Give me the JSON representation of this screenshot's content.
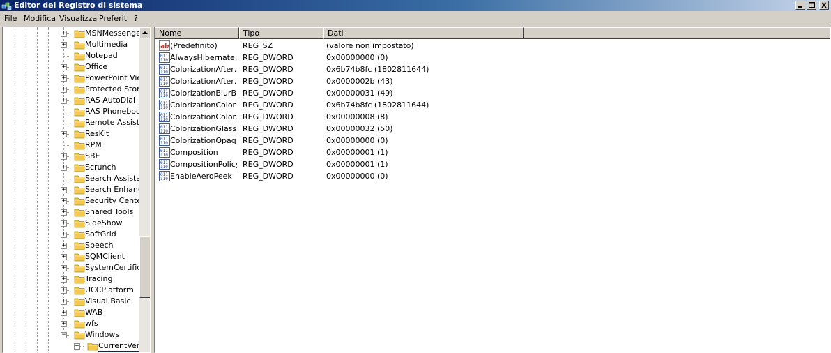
{
  "window": {
    "title": "Editor del Registro di sistema",
    "controls": [
      "_",
      "□",
      "×"
    ]
  },
  "menu": [
    "File",
    "Modifica",
    "Visualizza",
    "Preferiti",
    "?"
  ],
  "tree": {
    "items": [
      {
        "label": "MSNMessenger",
        "expander": "+"
      },
      {
        "label": "Multimedia",
        "expander": "+"
      },
      {
        "label": "Notepad",
        "expander": ""
      },
      {
        "label": "Office",
        "expander": "+"
      },
      {
        "label": "PowerPoint View",
        "expander": "+"
      },
      {
        "label": "Protected Storag",
        "expander": "+"
      },
      {
        "label": "RAS AutoDial",
        "expander": "+"
      },
      {
        "label": "RAS Phonebook",
        "expander": ""
      },
      {
        "label": "Remote Assistar",
        "expander": ""
      },
      {
        "label": "ResKit",
        "expander": "+"
      },
      {
        "label": "RPM",
        "expander": ""
      },
      {
        "label": "SBE",
        "expander": "+"
      },
      {
        "label": "Scrunch",
        "expander": "+"
      },
      {
        "label": "Search Assistant",
        "expander": ""
      },
      {
        "label": "Search Enhance",
        "expander": "+"
      },
      {
        "label": "Security Center",
        "expander": "+"
      },
      {
        "label": "Shared Tools",
        "expander": "+"
      },
      {
        "label": "SideShow",
        "expander": "+"
      },
      {
        "label": "SoftGrid",
        "expander": "+"
      },
      {
        "label": "Speech",
        "expander": "+"
      },
      {
        "label": "SQMClient",
        "expander": "+"
      },
      {
        "label": "SystemCertificat",
        "expander": "+"
      },
      {
        "label": "Tracing",
        "expander": "+"
      },
      {
        "label": "UCCPlatform",
        "expander": "+"
      },
      {
        "label": "Visual Basic",
        "expander": "+"
      },
      {
        "label": "WAB",
        "expander": "+"
      },
      {
        "label": "wfs",
        "expander": "+"
      },
      {
        "label": "Windows",
        "expander": "−"
      },
      {
        "label": "CurrentVers",
        "expander": "+",
        "child": true
      }
    ]
  },
  "list": {
    "columns": [
      "Nome",
      "Tipo",
      "Dati"
    ],
    "rows": [
      {
        "icon": "string-value-icon",
        "name": "(Predefinito)",
        "type": "REG_SZ",
        "data": "(valore non impostato)"
      },
      {
        "icon": "binary-value-icon",
        "name": "AlwaysHibernate…",
        "type": "REG_DWORD",
        "data": "0x00000000 (0)"
      },
      {
        "icon": "binary-value-icon",
        "name": "ColorizationAfter…",
        "type": "REG_DWORD",
        "data": "0x6b74b8fc (1802811644)"
      },
      {
        "icon": "binary-value-icon",
        "name": "ColorizationAfter…",
        "type": "REG_DWORD",
        "data": "0x0000002b (43)"
      },
      {
        "icon": "binary-value-icon",
        "name": "ColorizationBlurB…",
        "type": "REG_DWORD",
        "data": "0x00000031 (49)"
      },
      {
        "icon": "binary-value-icon",
        "name": "ColorizationColor",
        "type": "REG_DWORD",
        "data": "0x6b74b8fc (1802811644)"
      },
      {
        "icon": "binary-value-icon",
        "name": "ColorizationColor…",
        "type": "REG_DWORD",
        "data": "0x00000008 (8)"
      },
      {
        "icon": "binary-value-icon",
        "name": "ColorizationGlass…",
        "type": "REG_DWORD",
        "data": "0x00000032 (50)"
      },
      {
        "icon": "binary-value-icon",
        "name": "ColorizationOpaq…",
        "type": "REG_DWORD",
        "data": "0x00000000 (0)"
      },
      {
        "icon": "binary-value-icon",
        "name": "Composition",
        "type": "REG_DWORD",
        "data": "0x00000001 (1)"
      },
      {
        "icon": "binary-value-icon",
        "name": "CompositionPolicy",
        "type": "REG_DWORD",
        "data": "0x00000001 (1)"
      },
      {
        "icon": "binary-value-icon",
        "name": "EnableAeroPeek",
        "type": "REG_DWORD",
        "data": "0x00000000 (0)"
      }
    ]
  },
  "colors": {
    "titlebar_start": "#0a246a",
    "titlebar_end": "#c8d6ea",
    "chrome": "#d4d0c8",
    "folder": "#f2c94c",
    "selection_underline": "#0a246a"
  }
}
